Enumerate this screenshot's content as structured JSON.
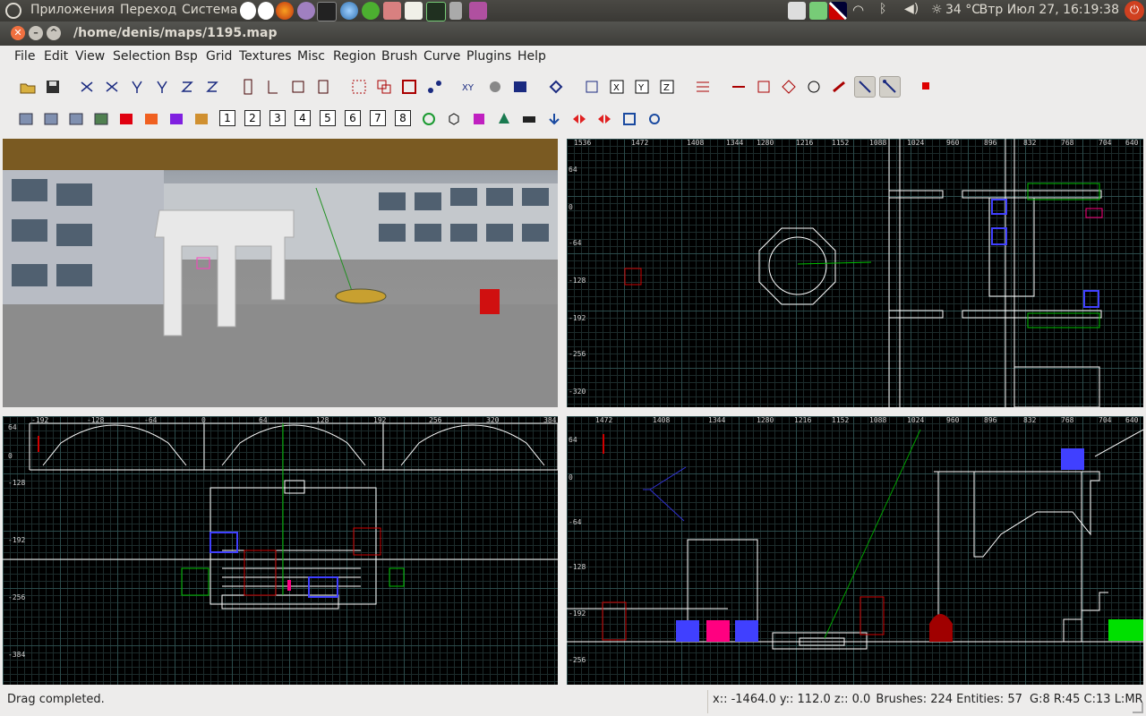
{
  "top_panel": {
    "menus": [
      "Приложения",
      "Переход",
      "Система"
    ],
    "temperature": "34 °C",
    "clock": "Втр Июл 27, 16:19:38"
  },
  "window": {
    "title": "/home/denis/maps/1195.map"
  },
  "menubar": [
    "File",
    "Edit",
    "View",
    "Selection",
    "Bsp",
    "Grid",
    "Textures",
    "Misc",
    "Region",
    "Brush",
    "Curve",
    "Plugins",
    "Help"
  ],
  "toolbar2": {
    "numbers": [
      "1",
      "2",
      "3",
      "4",
      "5",
      "6",
      "7",
      "8"
    ]
  },
  "viewports": {
    "top_right": {
      "x_ticks": [
        "1536",
        "1472",
        "1408",
        "1344",
        "1280",
        "1216",
        "1152",
        "1088",
        "1024",
        "960",
        "896",
        "832",
        "768",
        "704",
        "640"
      ],
      "y_ticks": [
        "64",
        "0",
        "-64",
        "-128",
        "-192",
        "-256",
        "-320"
      ]
    },
    "bottom_left": {
      "x_ticks": [
        "-192",
        "-128",
        "-64",
        "0",
        "64",
        "128",
        "192",
        "256",
        "320",
        "384",
        "448",
        "512",
        "576",
        "640"
      ],
      "y_ticks": [
        "64",
        "0",
        "-64",
        "-128",
        "-192",
        "-256",
        "-320",
        "-384"
      ]
    },
    "bottom_right": {
      "x_ticks": [
        "1472",
        "1408",
        "1344",
        "1280",
        "1216",
        "1152",
        "1088",
        "1024",
        "960",
        "896",
        "832",
        "768",
        "704",
        "640"
      ],
      "y_ticks": [
        "64",
        "0",
        "-64",
        "-128",
        "-192",
        "-256"
      ]
    }
  },
  "statusbar": {
    "message": "Drag completed.",
    "coords": "x:: -1464.0  y:: 112.0  z:: 0.0",
    "counts": "Brushes: 224 Entities: 57",
    "grid_info": "G:8 R:45 C:13 L:MR"
  },
  "colors": {
    "panel": "#3c3b37",
    "window_bg": "#edeceb",
    "grid_major": "#2b4b4b",
    "grid_minor": "#1c2b2b",
    "brush_white": "#ffffff",
    "entity_green": "#00c000",
    "entity_blue": "#4040ff",
    "entity_red": "#d00000",
    "entity_magenta": "#ff0080"
  }
}
